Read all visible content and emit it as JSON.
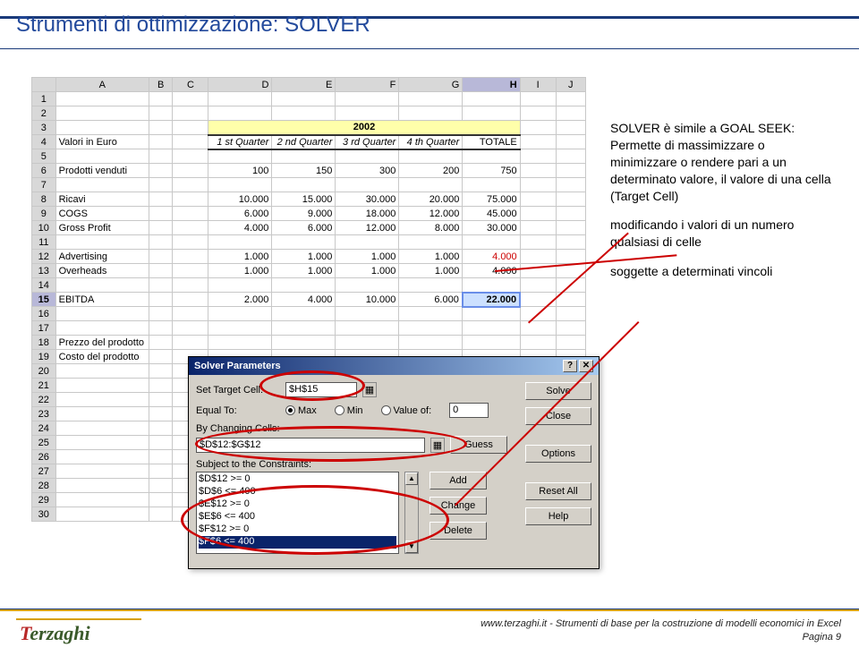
{
  "page": {
    "title": "Strumenti di ottimizzazione: SOLVER"
  },
  "sheet": {
    "colHeads": [
      "A",
      "B",
      "C",
      "D",
      "E",
      "F",
      "G",
      "H",
      "I",
      "J"
    ],
    "yearTitle": "2002",
    "rowLabels": {
      "valori": "Valori in Euro",
      "q1": "1 st Quarter",
      "q2": "2 nd Quarter",
      "q3": "3 rd Quarter",
      "q4": "4 th Quarter",
      "totale": "TOTALE",
      "prodotti": "Prodotti venduti",
      "ricavi": "Ricavi",
      "cogs": "COGS",
      "gross": "Gross Profit",
      "adv": "Advertising",
      "ovh": "Overheads",
      "ebitda": "EBITDA",
      "prezzo": "Prezzo del prodotto",
      "costo": "Costo del prodotto"
    },
    "data": {
      "prodotti": [
        "100",
        "150",
        "300",
        "200",
        "750"
      ],
      "ricavi": [
        "10.000",
        "15.000",
        "30.000",
        "20.000",
        "75.000"
      ],
      "cogs": [
        "6.000",
        "9.000",
        "18.000",
        "12.000",
        "45.000"
      ],
      "gross": [
        "4.000",
        "6.000",
        "12.000",
        "8.000",
        "30.000"
      ],
      "adv": [
        "1.000",
        "1.000",
        "1.000",
        "1.000",
        "4.000"
      ],
      "ovh": [
        "1.000",
        "1.000",
        "1.000",
        "1.000",
        "4.000"
      ],
      "ebitda": [
        "2.000",
        "4.000",
        "10.000",
        "6.000",
        "22.000"
      ]
    }
  },
  "side": {
    "p1a": "SOLVER è simile a GOAL SEEK:",
    "p1b": "Permette di massimizzare o minimizzare o rendere pari a un determinato valore, il valore di una cella (Target Cell)",
    "p2": "modificando i valori di un numero qualsiasi di celle",
    "p3": "soggette a determinati vincoli"
  },
  "dialog": {
    "title": "Solver Parameters",
    "labels": {
      "target": "Set Target Cell:",
      "equal": "Equal To:",
      "max": "Max",
      "min": "Min",
      "valueof": "Value of:",
      "bychanging": "By Changing Cells:",
      "subject": "Subject to the Constraints:"
    },
    "inputs": {
      "target": "$H$15",
      "valueof": "0",
      "changing": "$D$12:$G$12"
    },
    "buttons": {
      "solve": "Solve",
      "close": "Close",
      "guess": "Guess",
      "add": "Add",
      "change": "Change",
      "delete": "Delete",
      "options": "Options",
      "resetall": "Reset All",
      "help": "Help"
    },
    "constraints": [
      "$D$12 >= 0",
      "$D$6 <= 400",
      "$E$12 >= 0",
      "$E$6 <= 400",
      "$F$12 >= 0",
      "$F$6 <= 400"
    ]
  },
  "footer": {
    "logo": "Terzaghi",
    "line": "www.terzaghi.it - Strumenti di base per la costruzione di modelli economici in Excel",
    "page": "Pagina 9"
  }
}
